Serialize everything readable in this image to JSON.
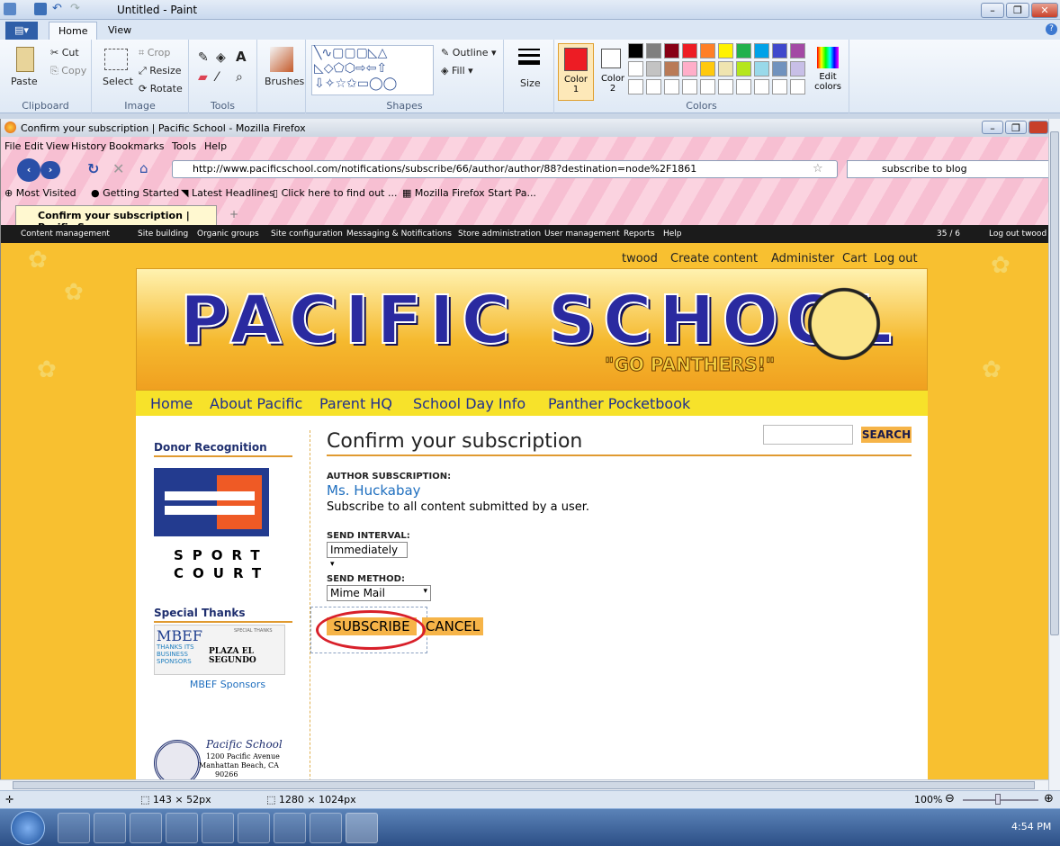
{
  "paint": {
    "title": "Untitled - Paint",
    "tabs": [
      "Home",
      "View"
    ],
    "clipboard": {
      "paste": "Paste",
      "cut": "Cut",
      "copy": "Copy",
      "label": "Clipboard"
    },
    "image": {
      "select": "Select",
      "crop": "Crop",
      "resize": "Resize",
      "rotate": "Rotate",
      "label": "Image"
    },
    "tools": {
      "label": "Tools"
    },
    "brushes": "Brushes",
    "shapes": {
      "outline": "Outline",
      "fill": "Fill",
      "label": "Shapes"
    },
    "size": "Size",
    "color1": "Color\n1",
    "color2": "Color\n2",
    "edit_colors": "Edit\ncolors",
    "colors_label": "Colors",
    "palette_row1": [
      "#000000",
      "#7f7f7f",
      "#880015",
      "#ed1c24",
      "#ff7f27",
      "#fff200",
      "#22b14c",
      "#00a2e8",
      "#3f48cc",
      "#a349a4"
    ],
    "palette_row2": [
      "#ffffff",
      "#c3c3c3",
      "#b97a57",
      "#ffaec9",
      "#ffc90e",
      "#efe4b0",
      "#b5e61d",
      "#99d9ea",
      "#7092be",
      "#c8bfe7"
    ],
    "status": {
      "selection": "143 × 52px",
      "canvas": "1280 × 1024px",
      "zoom": "100%"
    }
  },
  "firefox": {
    "title": "Confirm your subscription | Pacific School - Mozilla Firefox",
    "menu": [
      "File",
      "Edit",
      "View",
      "History",
      "Bookmarks",
      "Tools",
      "Help"
    ],
    "url": "http://www.pacificschool.com/notifications/subscribe/66/author/author/88?destination=node%2F1861",
    "search": "subscribe to blog",
    "bookmarks": [
      "Most Visited",
      "Getting Started",
      "Latest Headlines",
      "Click here to find out ...",
      "Mozilla Firefox Start Pa..."
    ],
    "tab": "Confirm your subscription | Pacific Sc..."
  },
  "admin": {
    "items": [
      "Content management",
      "Site building",
      "Organic groups",
      "Site configuration",
      "Messaging & Notifications",
      "Store administration",
      "User management",
      "Reports",
      "Help"
    ],
    "count": "35 / 6",
    "logout": "Log out twood"
  },
  "site": {
    "userlinks": [
      "twood",
      "Create content",
      "Administer",
      "Cart",
      "Log out"
    ],
    "logo": "PACIFIC SCHOOL",
    "motto": "\"GO PANTHERS!\"",
    "nav": [
      "Home",
      "About Pacific",
      "Parent HQ",
      "School Day Info",
      "Panther Pocketbook"
    ],
    "search_button": "SEARCH",
    "sidebar": {
      "donor": "Donor Recognition",
      "sport1": "SPORT",
      "sport2": "COURT",
      "thanks": "Special Thanks",
      "mbef": "MBEF Sponsors",
      "mbef_logo": "MBEF",
      "mbef_sub": "THANKS ITS BUSINESS SPONSORS",
      "plaza": "PLAZA EL SEGUNDO",
      "special": "SPECIAL THANKS",
      "seal_name": "Pacific School",
      "seal_addr1": "1200 Pacific Avenue",
      "seal_addr2": "Manhattan Beach, CA",
      "seal_zip": "90266"
    },
    "page": {
      "title": "Confirm your subscription",
      "author_label": "AUTHOR SUBSCRIPTION:",
      "author": "Ms. Huckabay",
      "author_desc": "Subscribe to all content submitted by a user.",
      "interval_label": "SEND INTERVAL:",
      "interval": "Immediately",
      "method_label": "SEND METHOD:",
      "method": "Mime Mail",
      "subscribe": "SUBSCRIBE",
      "cancel": "CANCEL"
    }
  },
  "taskbar": {
    "time": "4:54 PM"
  }
}
